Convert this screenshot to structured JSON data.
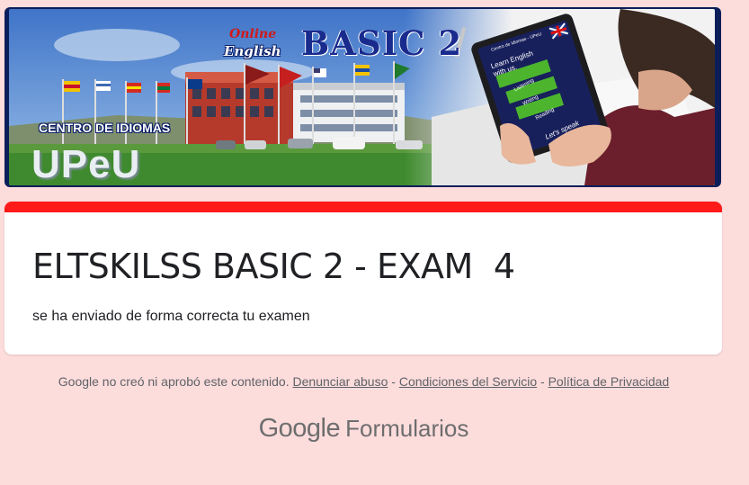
{
  "banner": {
    "online": "Online",
    "english": "English",
    "level": "BASIC 2",
    "centro": "CENTRO DE IDIOMAS",
    "logo": "UPeU",
    "tablet": {
      "header": "Centro de Idiomas - UPeU",
      "learn": "Learn English with us.",
      "options": [
        "Listening",
        "Writing",
        "Reading"
      ],
      "speak": "Let's speak"
    }
  },
  "form": {
    "title": "ELTSKILSS BASIC 2 - EXAM  4",
    "confirmation": "se ha enviado de forma correcta tu examen",
    "accent_color": "#ff1a1a"
  },
  "footer": {
    "disclaimer": "Google no creó ni aprobó este contenido.",
    "links": [
      "Denunciar abuso",
      "Condiciones del Servicio",
      "Política de Privacidad"
    ],
    "separator": "-"
  },
  "brand": {
    "google": "Google",
    "product": "Formularios"
  }
}
